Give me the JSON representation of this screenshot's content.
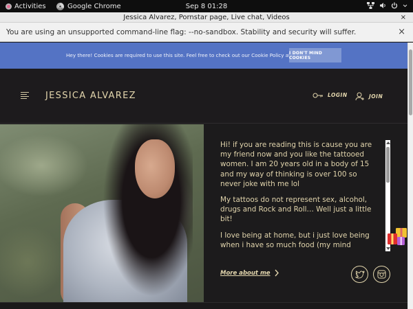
{
  "system_bar": {
    "activities": "Activities",
    "app_name": "Google Chrome",
    "clock": "Sep 8  01:28"
  },
  "window": {
    "title": "Jessica Alvarez, Pornstar page, Live chat, Videos",
    "close_symbol": "×"
  },
  "infobar": {
    "message": "You are using an unsupported command-line flag: --no-sandbox. Stability and security will suffer.",
    "close_symbol": "×"
  },
  "cookie_banner": {
    "text": "Hey there! Cookies are required to use this site. Feel free to check out our Cookie Policy at any time.",
    "button": "I DON'T MIND COOKIES"
  },
  "header": {
    "site_title": "JESSICA ALVAREZ",
    "login": "LOGIN",
    "join": "JOIN"
  },
  "bio": {
    "paragraphs": [
      "Hi! if you are reading this is cause you are my friend now and you like the tattooed women. I am 20 years old in a body of 15 and my way of thinking is over 100 so never joke with me lol",
      "My tattoos do not represent sex, alcohol, drugs and Rock and Roll… Well just a little bit!",
      "I love being at home, but i just love being when i have so much food (my mind controls"
    ],
    "more_link": "More about me"
  },
  "colors": {
    "accent_gold": "#e3d6ad",
    "cookie_blue": "#5473c4",
    "page_bg": "#1d1b1d"
  }
}
